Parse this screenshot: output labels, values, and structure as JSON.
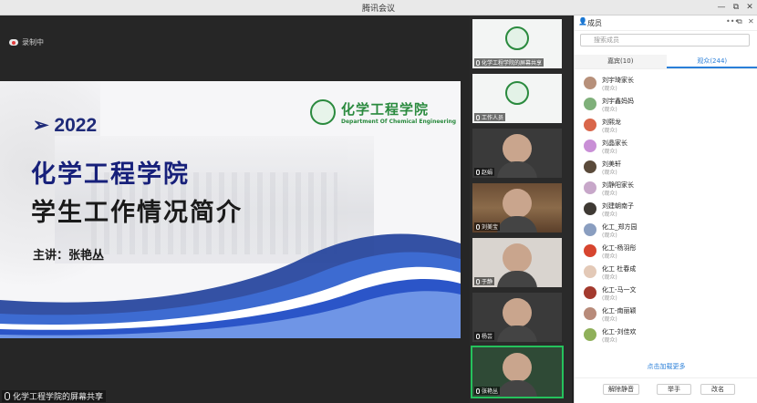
{
  "window": {
    "title": "腾讯会议",
    "min": "—",
    "max": "⧉",
    "close": "✕"
  },
  "recording": {
    "label": "录制中"
  },
  "slide": {
    "year": "➢ 2022",
    "title_line1": "化学工程学院",
    "title_line2": "学生工作情况简介",
    "speaker": "主讲：张艳丛",
    "logo_cn": "化学工程学院",
    "logo_en": "Department Of Chemical Engineering"
  },
  "share_label": "化学工程学院的屏幕共享",
  "thumbnails": [
    {
      "label": "化学工程学院的屏幕共享",
      "kind": "logo"
    },
    {
      "label": "工作人员",
      "kind": "logo"
    },
    {
      "label": "赵娟",
      "kind": "person"
    },
    {
      "label": "刘美宝",
      "kind": "shelf"
    },
    {
      "label": "于静",
      "kind": "light"
    },
    {
      "label": "杨芸",
      "kind": "person"
    },
    {
      "label": "张艳丛",
      "kind": "green"
    }
  ],
  "panel": {
    "title": "成员",
    "search_placeholder": "搜索成员",
    "tabs": [
      {
        "label": "嘉宾(10)"
      },
      {
        "label": "观众(244)"
      }
    ],
    "members": [
      {
        "name": "刘宇琦家长",
        "role": "(观众)",
        "color": "#b7907a"
      },
      {
        "name": "刘宇鑫妈妈",
        "role": "(观众)",
        "color": "#7fb07a"
      },
      {
        "name": "刘熙龙",
        "role": "(观众)",
        "color": "#d9664a"
      },
      {
        "name": "刘晶家长",
        "role": "(观众)",
        "color": "#c98fd6"
      },
      {
        "name": "刘美轩",
        "role": "(观众)",
        "color": "#5a4a3a"
      },
      {
        "name": "刘静阳家长",
        "role": "(观众)",
        "color": "#c7a7c9"
      },
      {
        "name": "刘建朝南子",
        "role": "(观众)",
        "color": "#3f3a34"
      },
      {
        "name": "化工_郑方园",
        "role": "(观众)",
        "color": "#8a9ec0"
      },
      {
        "name": "化工-杨羽彤",
        "role": "(观众)",
        "color": "#d7452f"
      },
      {
        "name": "化工 杜春成",
        "role": "(观众)",
        "color": "#e3c9b7"
      },
      {
        "name": "化工-马一文",
        "role": "(观众)",
        "color": "#a33a2e"
      },
      {
        "name": "化工-南丽颖",
        "role": "(观众)",
        "color": "#b88b7a"
      },
      {
        "name": "化工-刘佳欢",
        "role": "(观众)",
        "color": "#8fb05a"
      }
    ],
    "load_more": "点击加载更多",
    "buttons": {
      "unmute_all": "解除静音",
      "raise_hand": "举手",
      "rename": "改名"
    }
  }
}
